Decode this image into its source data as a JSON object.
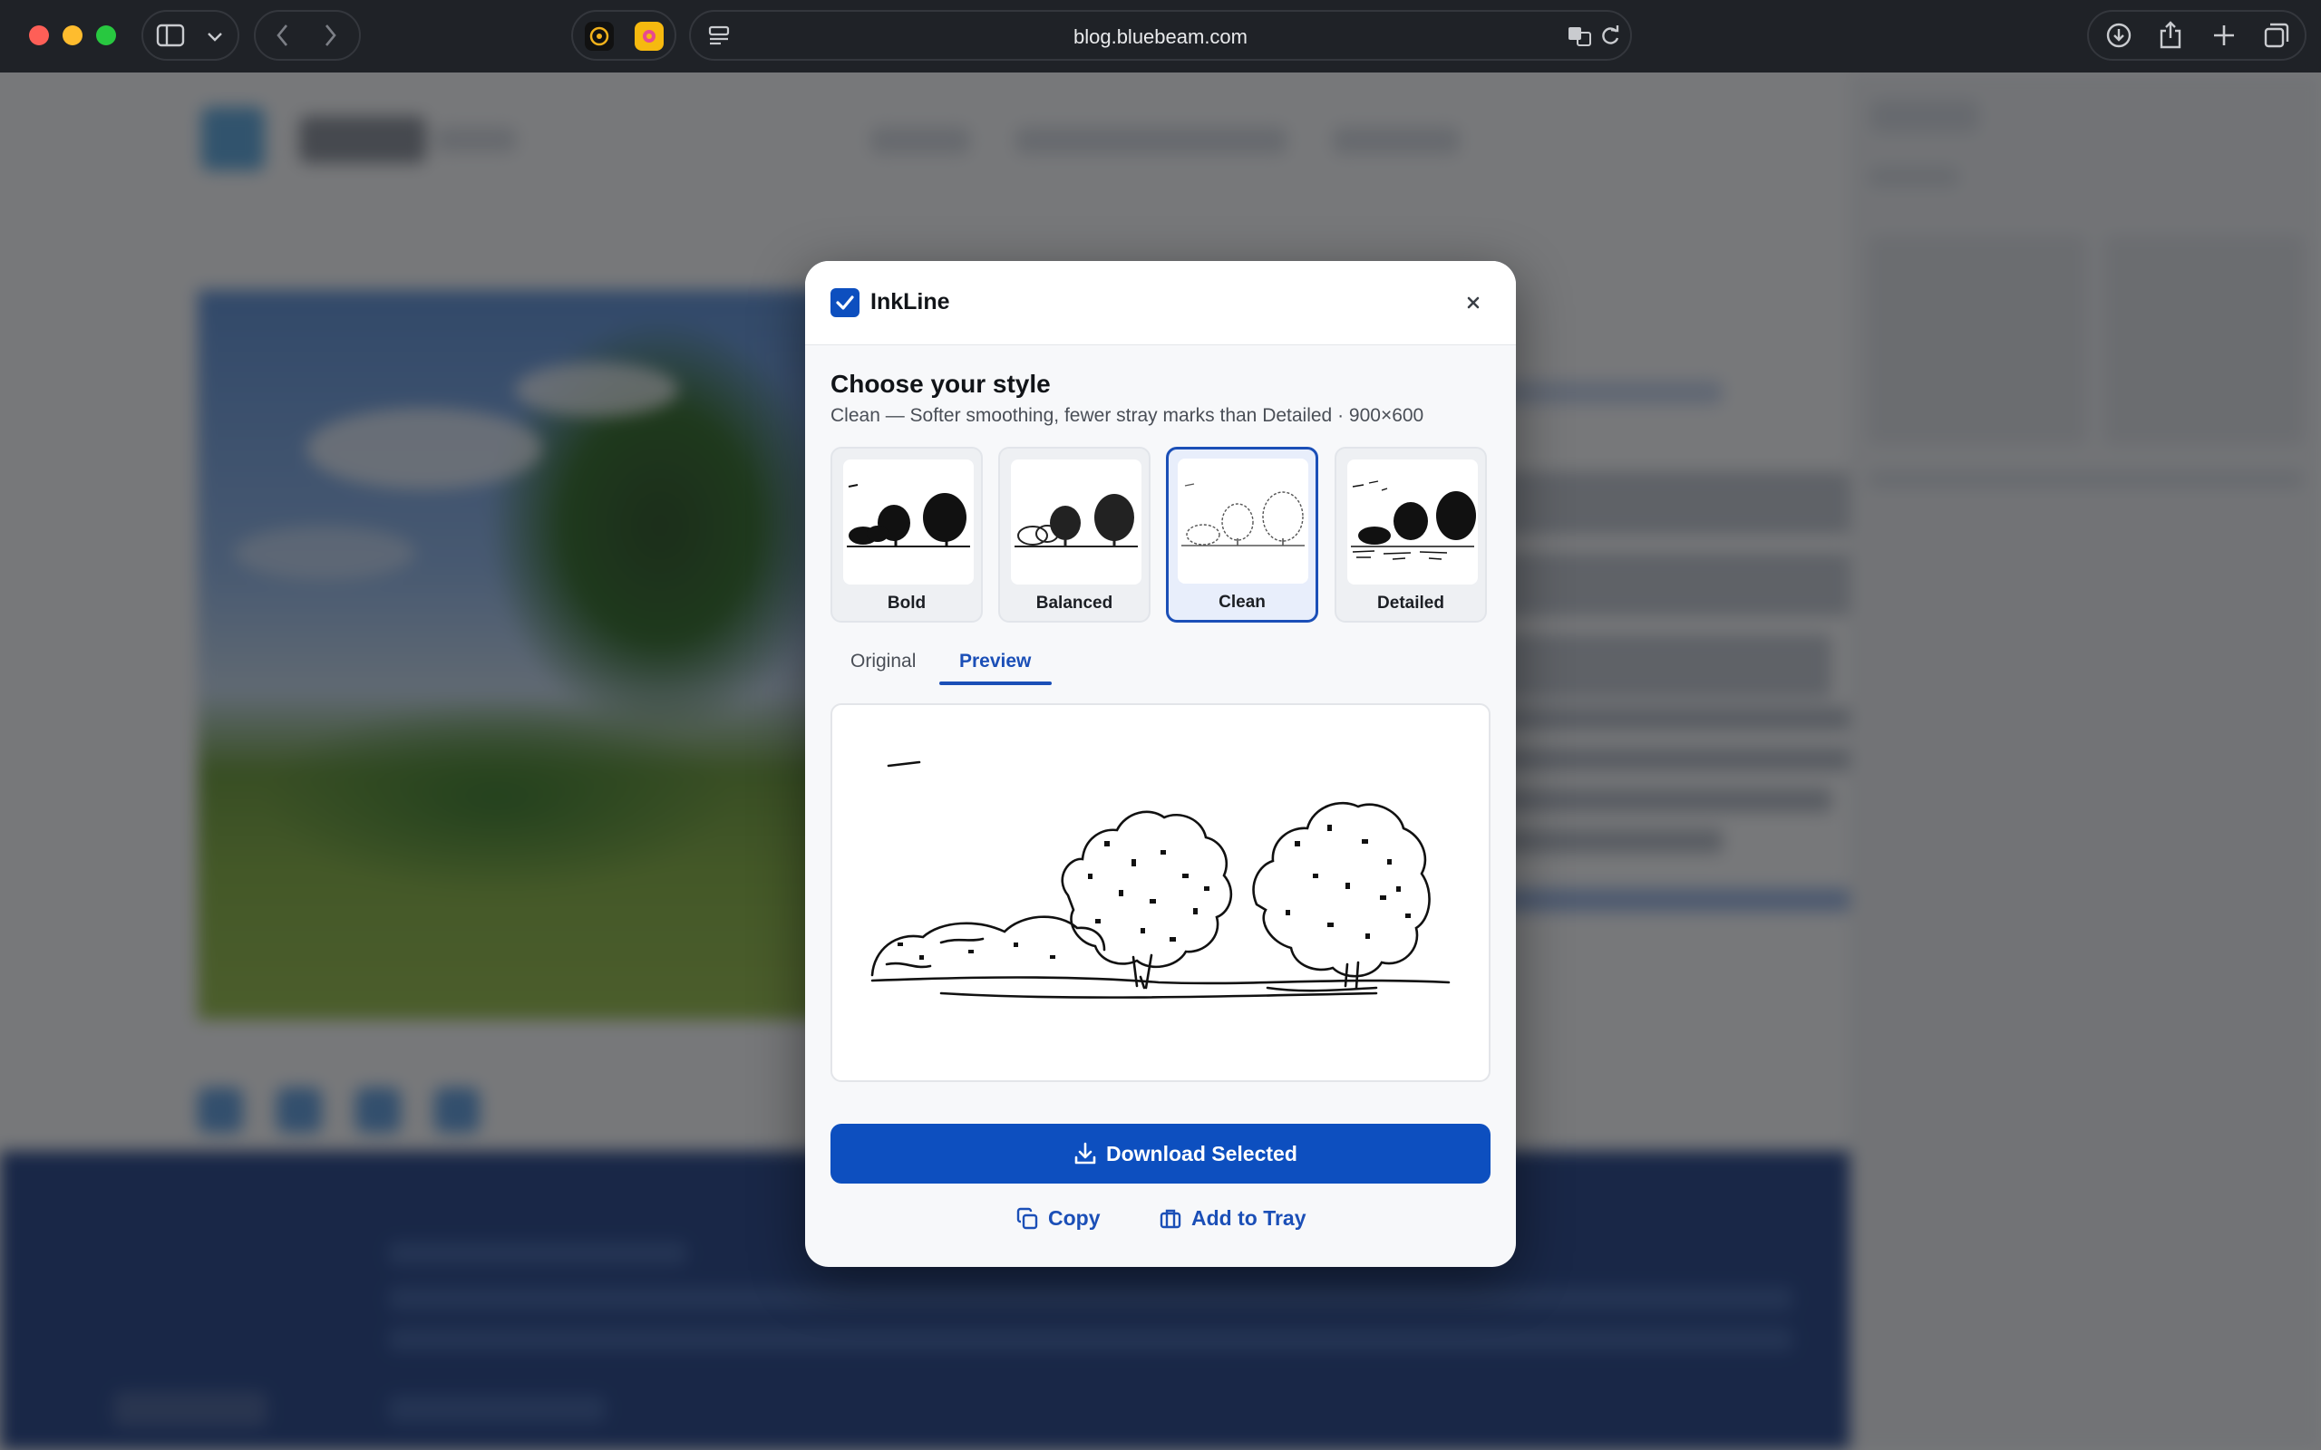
{
  "browser": {
    "url": "blog.bluebeam.com"
  },
  "modal": {
    "app_name": "InkLine",
    "heading": "Choose your style",
    "subtitle": "Clean — Softer smoothing, fewer stray marks than Detailed · 900×600",
    "styles": [
      {
        "label": "Bold"
      },
      {
        "label": "Balanced"
      },
      {
        "label": "Clean"
      },
      {
        "label": "Detailed"
      }
    ],
    "selected_style": "Clean",
    "tabs": {
      "original": "Original",
      "preview": "Preview"
    },
    "active_tab": "Preview",
    "download_label": "Download Selected",
    "copy_label": "Copy",
    "tray_label": "Add to Tray"
  },
  "colors": {
    "accent": "#0d4fbf",
    "modal_bg": "#f7f8fa"
  }
}
